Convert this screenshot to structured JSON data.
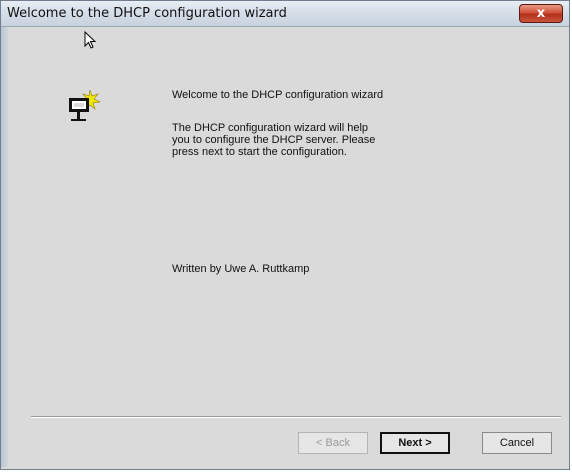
{
  "window": {
    "title": "Welcome to the DHCP configuration wizard",
    "close_label": "x"
  },
  "content": {
    "heading": "Welcome to the DHCP configuration wizard",
    "description": "The DHCP configuration wizard will help you to configure the DHCP server. Please press next to start the configuration.",
    "author": "Written by Uwe A. Ruttkamp"
  },
  "buttons": {
    "back_label": "< Back",
    "next_label": "Next >",
    "cancel_label": "Cancel"
  },
  "icons": {
    "wizard": "monitor-with-sparkle-icon",
    "cursor": "mouse-pointer-icon"
  },
  "colors": {
    "window_background": "#dadada",
    "close_button": "#c9543c"
  }
}
